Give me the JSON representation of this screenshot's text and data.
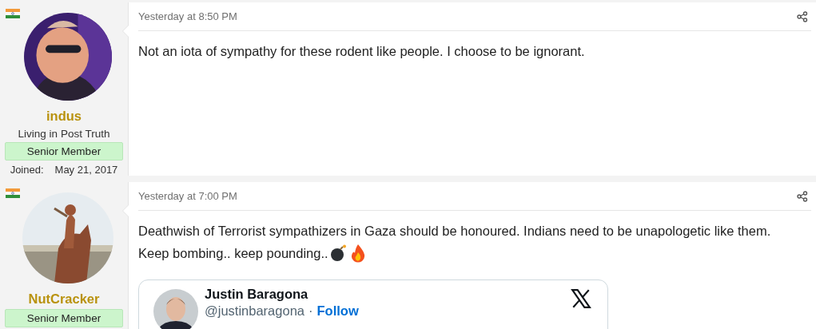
{
  "posts": [
    {
      "author": {
        "name": "indus",
        "user_title": "Living in Post Truth",
        "rank": "Senior Member",
        "joined_label": "Joined:",
        "joined_date": "May 21, 2017"
      },
      "time": "Yesterday at 8:50 PM",
      "message": [
        {
          "kind": "plain",
          "text": "Not an iota of sympathy for these rodent like people. I choose to be ignorant."
        }
      ]
    },
    {
      "author": {
        "name": "NutCracker",
        "rank": "Senior Member"
      },
      "time": "Yesterday at 7:00 PM",
      "message": [
        {
          "kind": "plain",
          "text": "Deathwish of Terrorist sympathizers in Gaza should be honoured. Indians need to be unapologetic like them."
        },
        {
          "kind": "with_emoji",
          "text": "Keep bombing.. keep pounding.."
        }
      ],
      "embed": {
        "name": "Justin Baragona",
        "handle": "@justinbaragona",
        "separator": "·",
        "follow": "Follow"
      }
    }
  ]
}
